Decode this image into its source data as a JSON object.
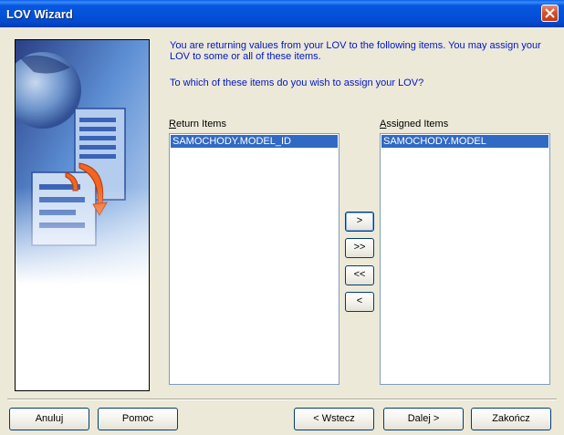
{
  "window": {
    "title": "LOV Wizard"
  },
  "intro_text": "You are returning values from your LOV to the following items. You may assign your LOV to some or all of these items.",
  "question_text": "To which of these items do you wish to assign your LOV?",
  "return_items": {
    "label_first": "R",
    "label_rest": "eturn Items",
    "items": [
      "SAMOCHODY.MODEL_ID"
    ]
  },
  "assigned_items": {
    "label_first": "A",
    "label_rest": "ssigned Items",
    "items": [
      "SAMOCHODY.MODEL"
    ]
  },
  "move_buttons": {
    "move_one": ">",
    "move_all": ">>",
    "remove_all": "<<",
    "remove_one": "<"
  },
  "footer": {
    "cancel": "Anuluj",
    "help": "Pomoc",
    "back": "< Wstecz",
    "next": "Dalej >",
    "finish": "Zakończ"
  }
}
